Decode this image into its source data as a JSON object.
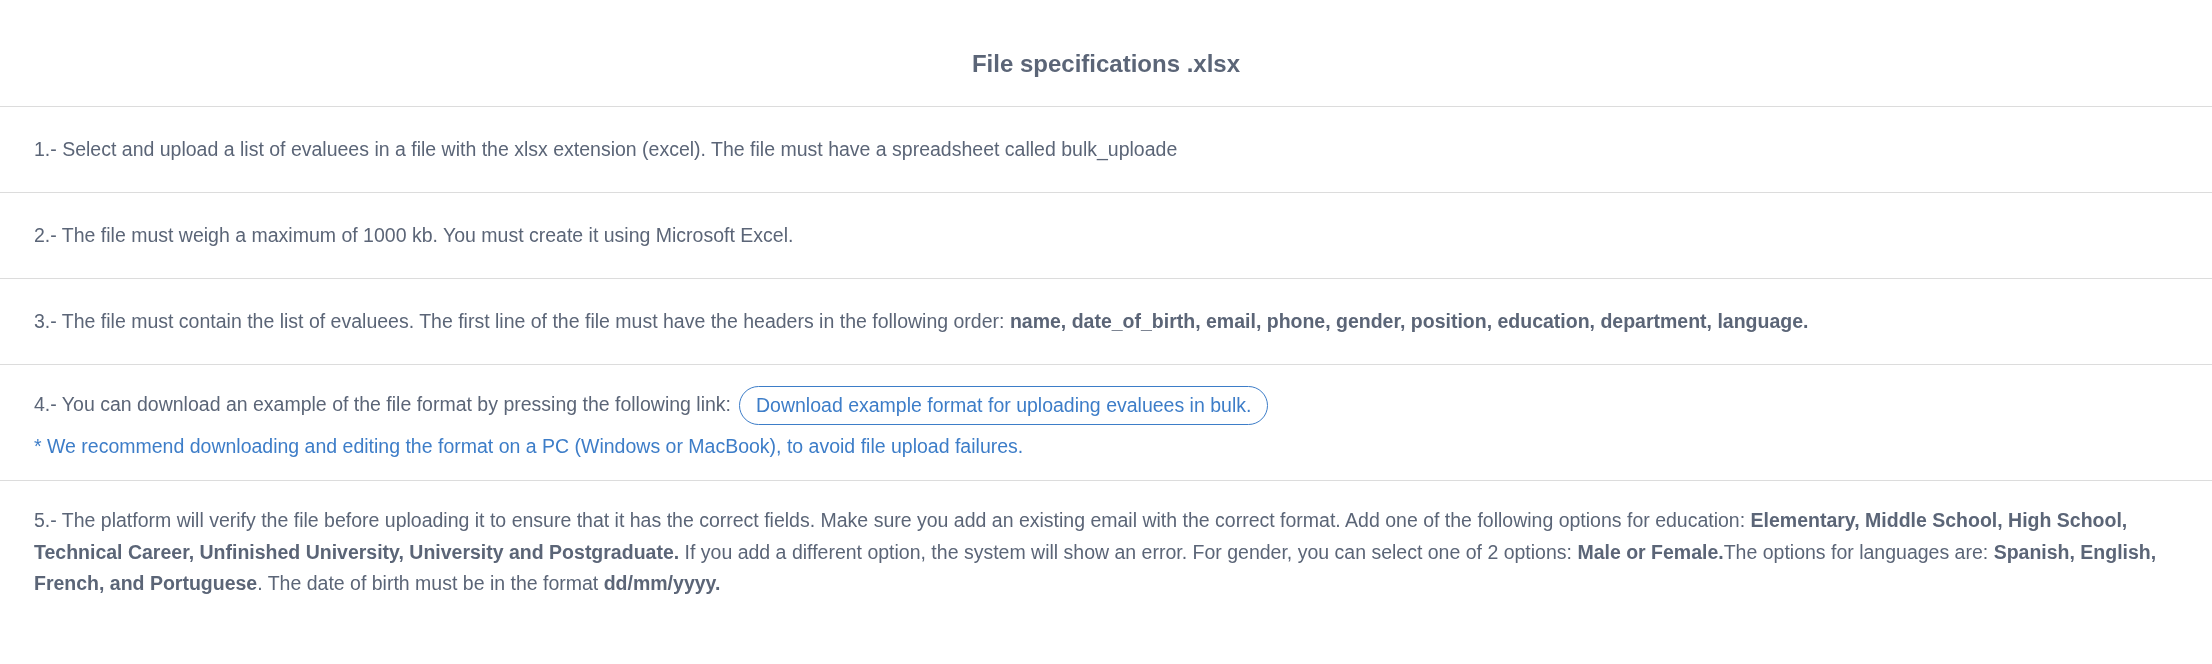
{
  "title": "File specifications .xlsx",
  "items": [
    {
      "kind": "text",
      "text": "1.- Select and upload a list of evaluees in a file with the xlsx extension (excel). The file must have a spreadsheet called bulk_uploade"
    },
    {
      "kind": "text",
      "text": "2.- The file must weigh a maximum of 1000 kb. You must create it using Microsoft Excel."
    },
    {
      "kind": "text",
      "text": "3.- The file must contain the list of evaluees. The first line of the file must have the headers in the following order: **name, date_of_birth, email, phone, gender, position, education, department, language.**"
    },
    {
      "kind": "download",
      "text": "4.- You can download an example of the file format by pressing the following link:",
      "link": "Download example format for uploading evaluees in bulk.",
      "note": "* We recommend downloading and editing the format on a PC (Windows or MacBook), to avoid file upload failures."
    },
    {
      "kind": "text",
      "text": "5.- The platform will verify the file before uploading it to ensure that it has the correct fields. Make sure you add an existing email with the correct format. Add one of the following options for education: **Elementary, Middle School, High School, Technical Career, Unfinished University, University and Postgraduate.** If you add a different option, the system will show an error. For gender, you can select one of 2 options: **Male or Female.**The options for languages are: **Spanish, English, French, and Portuguese**. The date of birth must be in the format **dd/mm/yyyy.**"
    }
  ]
}
